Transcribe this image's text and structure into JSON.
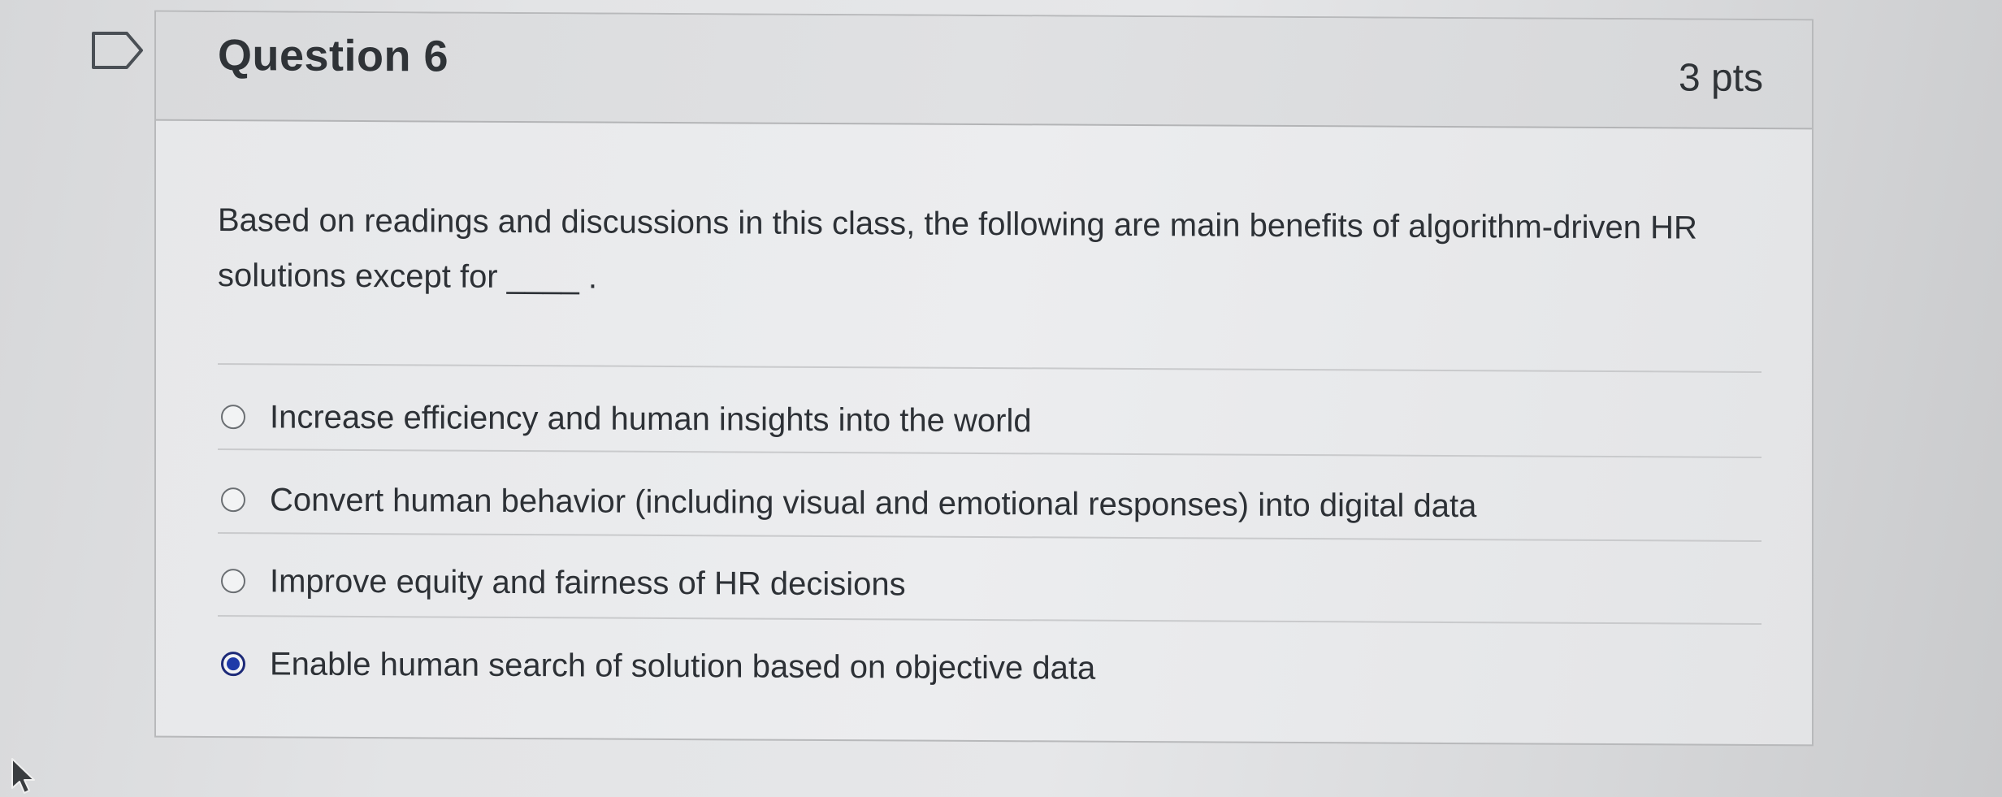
{
  "question": {
    "title": "Question 6",
    "points": "3 pts",
    "text": "Based on readings and discussions in this class, the following are main benefits of algorithm-driven HR solutions except for ____ .",
    "answers": [
      {
        "label": "Increase efficiency and human insights into the world",
        "selected": false
      },
      {
        "label": "Convert human behavior (including visual and emotional responses) into digital data",
        "selected": false
      },
      {
        "label": "Improve equity and fairness of HR decisions",
        "selected": false
      },
      {
        "label": "Enable human search of solution based on objective data",
        "selected": true
      }
    ]
  },
  "icons": {
    "flag": "bookmark-flag-icon",
    "cursor": "mouse-pointer-icon"
  },
  "colors": {
    "selected_radio": "#1f3aa8"
  }
}
